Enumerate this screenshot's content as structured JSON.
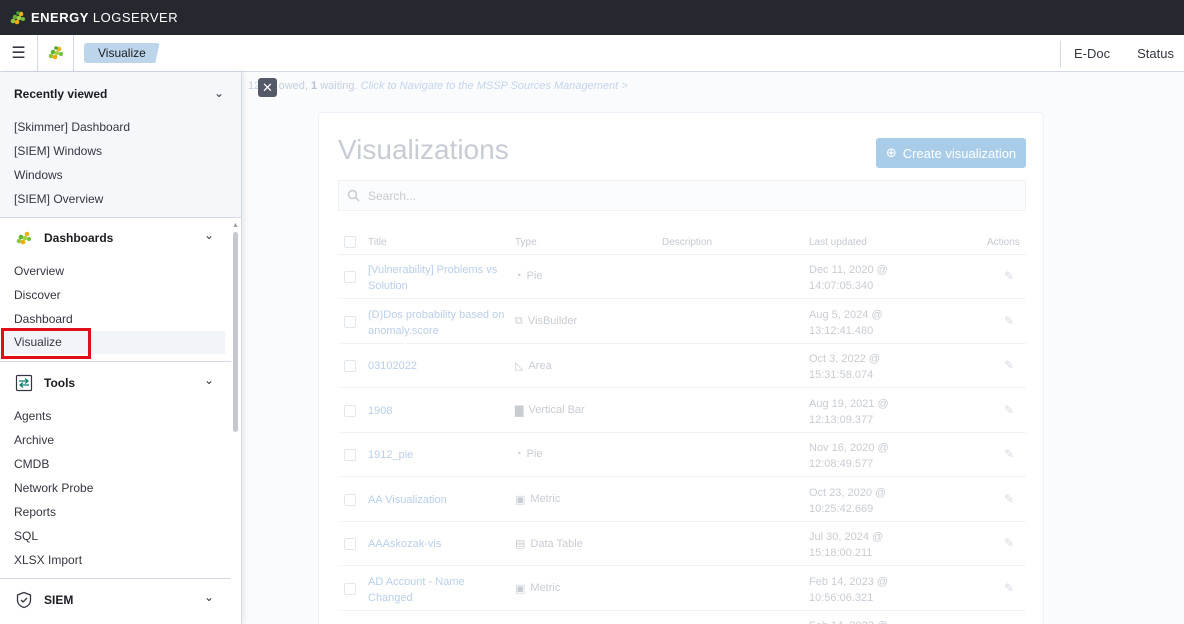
{
  "brand": {
    "part1": "ENERGY",
    "part2": "LOGSERVER"
  },
  "header": {
    "breadcrumb": "Visualize",
    "links": [
      "E-Doc",
      "Status"
    ]
  },
  "alert": {
    "count_prefix": "12",
    "text_mid": "owed, ",
    "waiting_count": "1",
    "waiting_text": " waiting. ",
    "link": "Click to Navigate to the MSSP Sources Management >"
  },
  "sidenav": {
    "recently_viewed": {
      "title": "Recently viewed",
      "items": [
        "[Skimmer] Dashboard",
        "[SIEM] Windows",
        "Windows",
        "[SIEM] Overview"
      ]
    },
    "dashboards": {
      "title": "Dashboards",
      "items": [
        "Overview",
        "Discover",
        "Dashboard",
        "Visualize"
      ]
    },
    "tools": {
      "title": "Tools",
      "items": [
        "Agents",
        "Archive",
        "CMDB",
        "Network Probe",
        "Reports",
        "SQL",
        "XLSX Import"
      ]
    },
    "siem": {
      "title": "SIEM"
    }
  },
  "main": {
    "title": "Visualizations",
    "create_button": "Create visualization",
    "search_placeholder": "Search...",
    "columns": [
      "Title",
      "Type",
      "Description",
      "Last updated",
      "Actions"
    ],
    "rows": [
      {
        "title": "[Vulnerability] Problems vs Solution",
        "type": "Pie",
        "type_icon": "pie-icon",
        "updated": "Dec 11, 2020 @ 14:07:05.340"
      },
      {
        "title": "(D)Dos probability based on anomaly.score",
        "type": "VisBuilder",
        "type_icon": "visbuilder-icon",
        "updated": "Aug 5, 2024 @ 13:12:41.480"
      },
      {
        "title": "03102022",
        "type": "Area",
        "type_icon": "area-icon",
        "updated": "Oct 3, 2022 @ 15:31:58.074"
      },
      {
        "title": "1908",
        "type": "Vertical Bar",
        "type_icon": "bar-icon",
        "updated": "Aug 19, 2021 @ 12:13:09.377"
      },
      {
        "title": "1912_pie",
        "type": "Pie",
        "type_icon": "pie-icon",
        "updated": "Nov 16, 2020 @ 12:08:49.577"
      },
      {
        "title": "AA Visualization",
        "type": "Metric",
        "type_icon": "metric-icon",
        "updated": "Oct 23, 2020 @ 10:25:42.669"
      },
      {
        "title": "AAAskozak-vis",
        "type": "Data Table",
        "type_icon": "table-icon",
        "updated": "Jul 30, 2024 @ 15:18:00.211"
      },
      {
        "title": "AD Account - Name Changed",
        "type": "Metric",
        "type_icon": "metric-icon",
        "updated": "Feb 14, 2023 @ 10:56:06.321"
      },
      {
        "title": "",
        "type": "",
        "type_icon": "",
        "updated": "Feb 14, 2023 @"
      }
    ]
  },
  "colors": {
    "topbar": "#25282f",
    "breadcrumb": "#bcd5ea",
    "highlight": "#e0101a",
    "create_button": "#a9cde8"
  }
}
